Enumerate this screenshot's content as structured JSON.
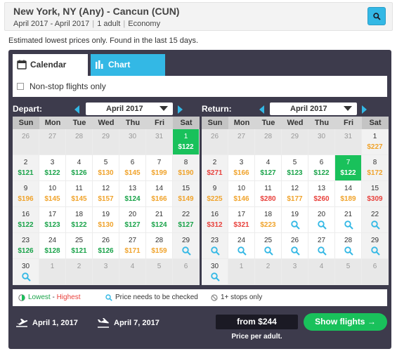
{
  "header": {
    "route": "New York, NY (Any) - Cancun (CUN)",
    "dates": "April 2017 - April 2017",
    "travelers": "1 adult",
    "cabin": "Economy",
    "search_icon": "search-icon"
  },
  "estimate_note": "Estimated lowest prices only. Found in the last 15 days.",
  "tabs": [
    {
      "label": "Calendar",
      "icon": "calendar-icon",
      "active": true
    },
    {
      "label": "Chart",
      "icon": "bar-chart-icon",
      "active": false
    }
  ],
  "nonstop_label": "Non-stop flights only",
  "weekdays": [
    "Sun",
    "Mon",
    "Tue",
    "Wed",
    "Thu",
    "Fri",
    "Sat"
  ],
  "depart": {
    "label": "Depart:",
    "month": "April 2017",
    "weeks": [
      [
        {
          "d": "26",
          "other": true
        },
        {
          "d": "27",
          "other": true
        },
        {
          "d": "28",
          "other": true
        },
        {
          "d": "29",
          "other": true
        },
        {
          "d": "30",
          "other": true
        },
        {
          "d": "31",
          "other": true
        },
        {
          "d": "1",
          "p": "$122",
          "c": "g",
          "sel": true
        }
      ],
      [
        {
          "d": "2",
          "p": "$121",
          "c": "g"
        },
        {
          "d": "3",
          "p": "$122",
          "c": "g"
        },
        {
          "d": "4",
          "p": "$126",
          "c": "g"
        },
        {
          "d": "5",
          "p": "$130",
          "c": "o"
        },
        {
          "d": "6",
          "p": "$145",
          "c": "o"
        },
        {
          "d": "7",
          "p": "$199",
          "c": "o"
        },
        {
          "d": "8",
          "p": "$190",
          "c": "o"
        }
      ],
      [
        {
          "d": "9",
          "p": "$196",
          "c": "o"
        },
        {
          "d": "10",
          "p": "$145",
          "c": "o"
        },
        {
          "d": "11",
          "p": "$145",
          "c": "o"
        },
        {
          "d": "12",
          "p": "$157",
          "c": "o"
        },
        {
          "d": "13",
          "p": "$124",
          "c": "g"
        },
        {
          "d": "14",
          "p": "$166",
          "c": "o"
        },
        {
          "d": "15",
          "p": "$149",
          "c": "o"
        }
      ],
      [
        {
          "d": "16",
          "p": "$122",
          "c": "g"
        },
        {
          "d": "17",
          "p": "$123",
          "c": "g"
        },
        {
          "d": "18",
          "p": "$122",
          "c": "g"
        },
        {
          "d": "19",
          "p": "$130",
          "c": "o"
        },
        {
          "d": "20",
          "p": "$127",
          "c": "g"
        },
        {
          "d": "21",
          "p": "$124",
          "c": "g"
        },
        {
          "d": "22",
          "p": "$127",
          "c": "g"
        }
      ],
      [
        {
          "d": "23",
          "p": "$126",
          "c": "g"
        },
        {
          "d": "24",
          "p": "$128",
          "c": "g"
        },
        {
          "d": "25",
          "p": "$121",
          "c": "g"
        },
        {
          "d": "26",
          "p": "$126",
          "c": "g"
        },
        {
          "d": "27",
          "p": "$171",
          "c": "o"
        },
        {
          "d": "28",
          "p": "$159",
          "c": "o"
        },
        {
          "d": "29",
          "q": true
        }
      ],
      [
        {
          "d": "30",
          "q": true
        },
        {
          "d": "1",
          "other": true
        },
        {
          "d": "2",
          "other": true
        },
        {
          "d": "3",
          "other": true
        },
        {
          "d": "4",
          "other": true
        },
        {
          "d": "5",
          "other": true
        },
        {
          "d": "6",
          "other": true
        }
      ]
    ]
  },
  "return": {
    "label": "Return:",
    "month": "April 2017",
    "weeks": [
      [
        {
          "d": "26",
          "other": true
        },
        {
          "d": "27",
          "other": true
        },
        {
          "d": "28",
          "other": true
        },
        {
          "d": "29",
          "other": true
        },
        {
          "d": "30",
          "other": true
        },
        {
          "d": "31",
          "other": true
        },
        {
          "d": "1",
          "p": "$227",
          "c": "o"
        }
      ],
      [
        {
          "d": "2",
          "p": "$271",
          "c": "r"
        },
        {
          "d": "3",
          "p": "$166",
          "c": "o"
        },
        {
          "d": "4",
          "p": "$127",
          "c": "g"
        },
        {
          "d": "5",
          "p": "$123",
          "c": "g"
        },
        {
          "d": "6",
          "p": "$122",
          "c": "g"
        },
        {
          "d": "7",
          "p": "$122",
          "c": "g",
          "sel": true
        },
        {
          "d": "8",
          "p": "$172",
          "c": "o"
        }
      ],
      [
        {
          "d": "9",
          "p": "$225",
          "c": "o"
        },
        {
          "d": "10",
          "p": "$146",
          "c": "o"
        },
        {
          "d": "11",
          "p": "$280",
          "c": "r"
        },
        {
          "d": "12",
          "p": "$177",
          "c": "o"
        },
        {
          "d": "13",
          "p": "$260",
          "c": "r"
        },
        {
          "d": "14",
          "p": "$189",
          "c": "o"
        },
        {
          "d": "15",
          "p": "$309",
          "c": "r"
        }
      ],
      [
        {
          "d": "16",
          "p": "$312",
          "c": "r"
        },
        {
          "d": "17",
          "p": "$321",
          "c": "r"
        },
        {
          "d": "18",
          "p": "$223",
          "c": "o"
        },
        {
          "d": "19",
          "q": true
        },
        {
          "d": "20",
          "q": true
        },
        {
          "d": "21",
          "q": true
        },
        {
          "d": "22",
          "q": true
        }
      ],
      [
        {
          "d": "23",
          "q": true
        },
        {
          "d": "24",
          "q": true
        },
        {
          "d": "25",
          "q": true
        },
        {
          "d": "26",
          "q": true
        },
        {
          "d": "27",
          "q": true
        },
        {
          "d": "28",
          "q": true
        },
        {
          "d": "29",
          "q": true
        }
      ],
      [
        {
          "d": "30",
          "q": true
        },
        {
          "d": "1",
          "other": true
        },
        {
          "d": "2",
          "other": true
        },
        {
          "d": "3",
          "other": true
        },
        {
          "d": "4",
          "other": true
        },
        {
          "d": "5",
          "other": true
        },
        {
          "d": "6",
          "other": true
        }
      ]
    ]
  },
  "legend": {
    "lowest": "Lowest",
    "dash": " - ",
    "highest": "Highest",
    "check": "Price needs to be checked",
    "stops": "1+ stops only"
  },
  "footer": {
    "depart_date": "April 1, 2017",
    "return_date": "April 7, 2017",
    "price": "from $244",
    "price_note": "Price per adult.",
    "show_button": "Show flights →"
  },
  "colors": {
    "accent": "#33b8e5",
    "success": "#19c15b",
    "price_low": "#1aa34a",
    "price_mid": "#f0a32b",
    "price_high": "#e8413c",
    "panel": "#3d3b4c"
  }
}
